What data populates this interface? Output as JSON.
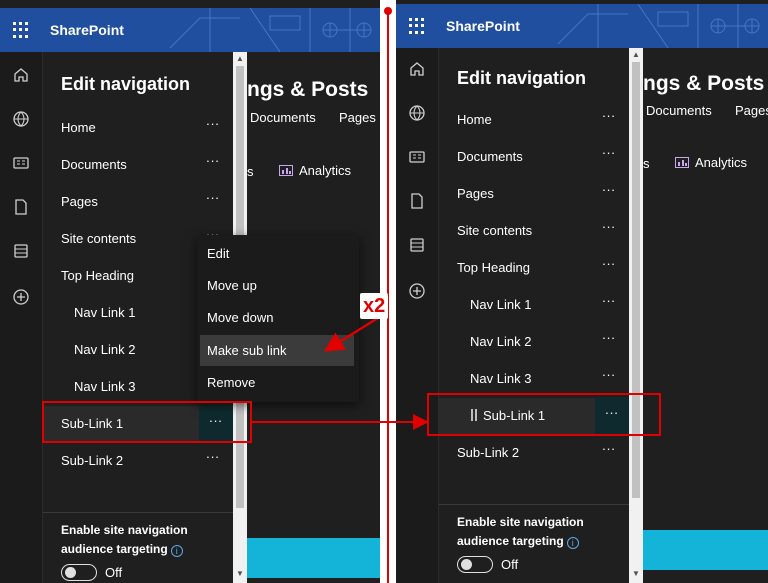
{
  "app": {
    "name": "SharePoint"
  },
  "site": {
    "title_fragment": "ngs & Posts",
    "links": [
      "Documents",
      "Pages"
    ],
    "tab_fragment": "s",
    "analytics_label": "Analytics"
  },
  "panel": {
    "title": "Edit navigation",
    "more_icon": "...",
    "before_items": [
      {
        "label": "Home",
        "level": 0
      },
      {
        "label": "Documents",
        "level": 0
      },
      {
        "label": "Pages",
        "level": 0
      },
      {
        "label": "Site contents",
        "level": 0
      },
      {
        "label": "Top Heading",
        "level": 0
      },
      {
        "label": "Nav Link 1",
        "level": 1
      },
      {
        "label": "Nav Link 2",
        "level": 1
      },
      {
        "label": "Nav Link 3",
        "level": 1
      },
      {
        "label": "Sub-Link 1",
        "level": 0
      },
      {
        "label": "Sub-Link 2",
        "level": 0
      }
    ],
    "after_items": [
      {
        "label": "Home",
        "level": 0
      },
      {
        "label": "Documents",
        "level": 0
      },
      {
        "label": "Pages",
        "level": 0
      },
      {
        "label": "Site contents",
        "level": 0
      },
      {
        "label": "Top Heading",
        "level": 0
      },
      {
        "label": "Nav Link 1",
        "level": 1
      },
      {
        "label": "Nav Link 2",
        "level": 1
      },
      {
        "label": "Nav Link 3",
        "level": 1
      },
      {
        "label": "Sub-Link 1",
        "level": 2
      },
      {
        "label": "Sub-Link 2",
        "level": 0
      }
    ],
    "footer": {
      "label": "Enable site navigation audience targeting",
      "toggle_state": "Off",
      "info_icon": "i"
    }
  },
  "context_menu": {
    "items": [
      "Edit",
      "Move up",
      "Move down",
      "Make sub link",
      "Remove"
    ],
    "hovered": "Make sub link"
  },
  "annotation": {
    "repeat_label": "x2",
    "color": "#e00000"
  },
  "colors": {
    "suitebar": "#1f4f9e",
    "panel_bg": "#1f1f1f",
    "accent_band": "#14b4d9",
    "info": "#59a8e8"
  }
}
